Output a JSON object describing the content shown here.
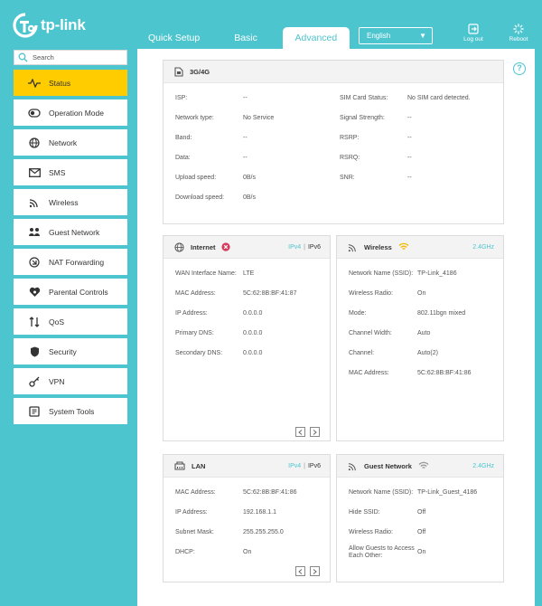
{
  "brand": {
    "name": "tp-link"
  },
  "tabs": [
    {
      "label": "Quick Setup",
      "active": false
    },
    {
      "label": "Basic",
      "active": false
    },
    {
      "label": "Advanced",
      "active": true
    }
  ],
  "language": {
    "selected": "English"
  },
  "header_buttons": {
    "logout": "Log out",
    "reboot": "Reboot"
  },
  "search": {
    "placeholder": "Search"
  },
  "sidebar": {
    "items": [
      {
        "label": "Status",
        "icon": "pulse-icon",
        "active": true
      },
      {
        "label": "Operation Mode",
        "icon": "toggle-icon"
      },
      {
        "label": "Network",
        "icon": "globe-icon"
      },
      {
        "label": "SMS",
        "icon": "envelope-icon"
      },
      {
        "label": "Wireless",
        "icon": "wifi-icon"
      },
      {
        "label": "Guest Network",
        "icon": "guests-icon"
      },
      {
        "label": "NAT Forwarding",
        "icon": "nat-icon"
      },
      {
        "label": "Parental Controls",
        "icon": "heart-icon"
      },
      {
        "label": "QoS",
        "icon": "arrows-icon"
      },
      {
        "label": "Security",
        "icon": "shield-icon"
      },
      {
        "label": "VPN",
        "icon": "key-icon"
      },
      {
        "label": "System Tools",
        "icon": "tools-icon"
      }
    ]
  },
  "cards": {
    "mobile": {
      "title": "3G/4G",
      "left": [
        {
          "label": "ISP:",
          "value": "--"
        },
        {
          "label": "Network type:",
          "value": "No Service"
        },
        {
          "label": "Band:",
          "value": "--"
        },
        {
          "label": "Data:",
          "value": "--"
        },
        {
          "label": "Upload speed:",
          "value": "0B/s"
        },
        {
          "label": "Download speed:",
          "value": "0B/s"
        }
      ],
      "right": [
        {
          "label": "SIM Card Status:",
          "value": "No SIM card detected."
        },
        {
          "label": "Signal Strength:",
          "value": "--"
        },
        {
          "label": "RSRP:",
          "value": "--"
        },
        {
          "label": "RSRQ:",
          "value": "--"
        },
        {
          "label": "SNR:",
          "value": "--"
        }
      ]
    },
    "internet": {
      "title": "Internet",
      "ipv4": "IPv4",
      "ipv6": "IPv6",
      "rows": [
        {
          "label": "WAN Interface Name:",
          "value": "LTE"
        },
        {
          "label": "MAC Address:",
          "value": "5C:62:8B:BF:41:87"
        },
        {
          "label": "IP Address:",
          "value": "0.0.0.0"
        },
        {
          "label": "Primary DNS:",
          "value": "0.0.0.0"
        },
        {
          "label": "Secondary DNS:",
          "value": "0.0.0.0"
        }
      ]
    },
    "wireless": {
      "title": "Wireless",
      "band": "2.4GHz",
      "rows": [
        {
          "label": "Network Name (SSID):",
          "value": "TP-Link_4186"
        },
        {
          "label": "Wireless Radio:",
          "value": "On"
        },
        {
          "label": "Mode:",
          "value": "802.11bgn mixed"
        },
        {
          "label": "Channel Width:",
          "value": "Auto"
        },
        {
          "label": "Channel:",
          "value": "Auto(2)"
        },
        {
          "label": "MAC Address:",
          "value": "5C:62:8B:BF:41:86"
        }
      ]
    },
    "lan": {
      "title": "LAN",
      "ipv4": "IPv4",
      "ipv6": "IPv6",
      "rows": [
        {
          "label": "MAC Address:",
          "value": "5C:62:8B:BF:41:86"
        },
        {
          "label": "IP Address:",
          "value": "192.168.1.1"
        },
        {
          "label": "Subnet Mask:",
          "value": "255.255.255.0"
        },
        {
          "label": "DHCP:",
          "value": "On"
        }
      ]
    },
    "guest": {
      "title": "Guest Network",
      "band": "2.4GHz",
      "rows": [
        {
          "label": "Network Name (SSID):",
          "value": "TP-Link_Guest_4186"
        },
        {
          "label": "Hide SSID:",
          "value": "Off"
        },
        {
          "label": "Wireless Radio:",
          "value": "Off"
        },
        {
          "label": "Allow Guests to Access",
          "label2": "Each Other:",
          "value": "On"
        }
      ]
    }
  }
}
